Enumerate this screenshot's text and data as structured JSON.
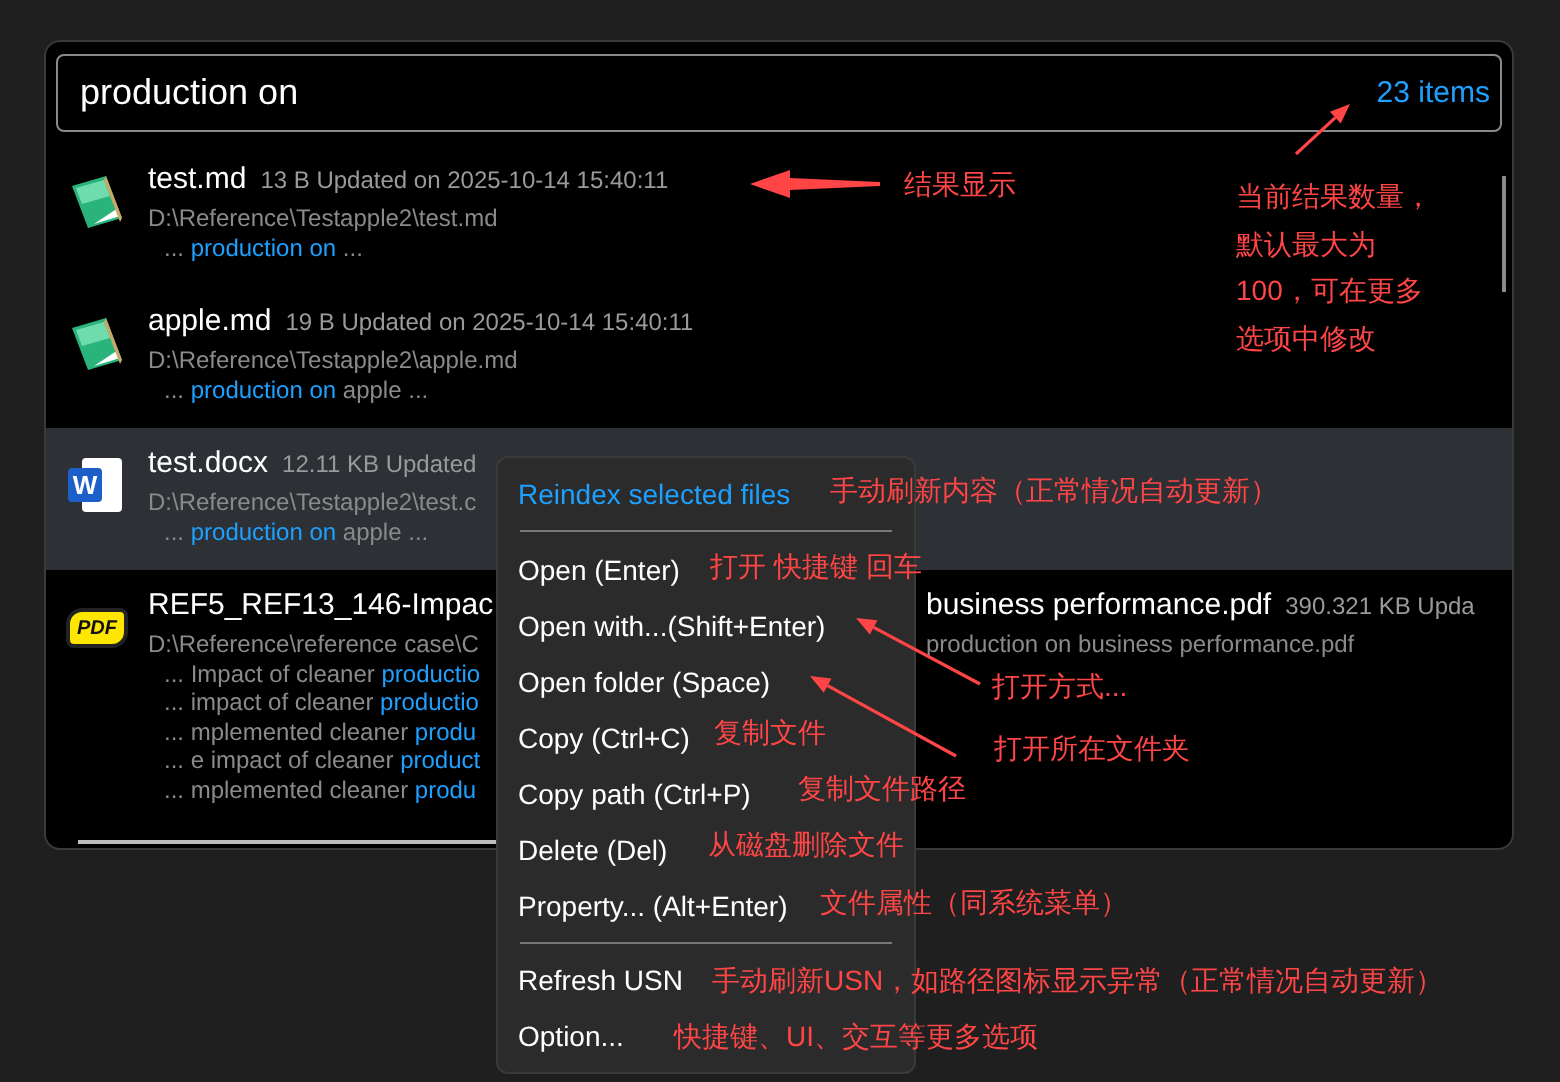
{
  "search": {
    "value": "production on",
    "count": "23 items"
  },
  "results": [
    {
      "name": "test.md",
      "meta": "13 B Updated on 2025-10-14 15:40:11",
      "path": "D:\\Reference\\Testapple2\\test.md",
      "selected": false,
      "icon": {
        "kind": "notepad"
      },
      "snippets": [
        {
          "before": "... ",
          "match": "production on",
          "after": " ..."
        }
      ]
    },
    {
      "name": "apple.md",
      "meta": "19 B Updated on 2025-10-14 15:40:11",
      "path": "D:\\Reference\\Testapple2\\apple.md",
      "selected": false,
      "icon": {
        "kind": "notepad"
      },
      "snippets": [
        {
          "before": "... ",
          "match": "production on",
          "after": " apple ..."
        }
      ]
    },
    {
      "name": "test.docx",
      "meta": "12.11 KB Updated",
      "path": "D:\\Reference\\Testapple2\\test.c",
      "selected": true,
      "icon": {
        "kind": "word",
        "label": "W"
      },
      "snippets": [
        {
          "before": "... ",
          "match": "production on",
          "after": " apple ..."
        }
      ]
    },
    {
      "name": "REF5_REF13_146-Impac",
      "name_after": "business performance.pdf",
      "meta_after": "390.321 KB Upda",
      "path": "D:\\Reference\\reference case\\C",
      "path_after": "production on business performance.pdf",
      "selected": false,
      "icon": {
        "kind": "pdf",
        "label": "PDF"
      },
      "snippets": [
        {
          "before": "... Impact of cleaner ",
          "match": "productio"
        },
        {
          "before": "... impact of cleaner ",
          "match": "productio"
        },
        {
          "before": "... mplemented cleaner ",
          "match": "produ"
        },
        {
          "before": "... e impact of cleaner ",
          "match": "product"
        },
        {
          "before": "... mplemented cleaner ",
          "match": "produ"
        }
      ]
    }
  ],
  "context_menu": [
    {
      "kind": "accent",
      "label": "Reindex selected files"
    },
    {
      "kind": "separator"
    },
    {
      "kind": "item",
      "label": "Open (Enter)"
    },
    {
      "kind": "item",
      "label": "Open with...(Shift+Enter)"
    },
    {
      "kind": "item",
      "label": "Open folder (Space)"
    },
    {
      "kind": "item",
      "label": "Copy (Ctrl+C)"
    },
    {
      "kind": "item",
      "label": "Copy path (Ctrl+P)"
    },
    {
      "kind": "item",
      "label": "Delete (Del)"
    },
    {
      "kind": "item",
      "label": "Property... (Alt+Enter)"
    },
    {
      "kind": "separator"
    },
    {
      "kind": "item",
      "label": "Refresh USN"
    },
    {
      "kind": "item",
      "label": "Option..."
    }
  ],
  "annotations": [
    {
      "text": "结果显示"
    },
    {
      "text": "当前结果数量，默认最大为100，可在更多选项中修改"
    },
    {
      "text": "手动刷新内容（正常情况自动更新）"
    },
    {
      "text": "打开 快捷键 回车"
    },
    {
      "text": "打开方式..."
    },
    {
      "text": "打开所在文件夹"
    },
    {
      "text": "复制文件"
    },
    {
      "text": "复制文件路径"
    },
    {
      "text": "从磁盘删除文件"
    },
    {
      "text": "文件属性（同系统菜单）"
    },
    {
      "text": "手动刷新USN，如路径图标显示异常（正常情况自动更新）"
    },
    {
      "text": "快捷键、UI、交互等更多选项"
    }
  ]
}
